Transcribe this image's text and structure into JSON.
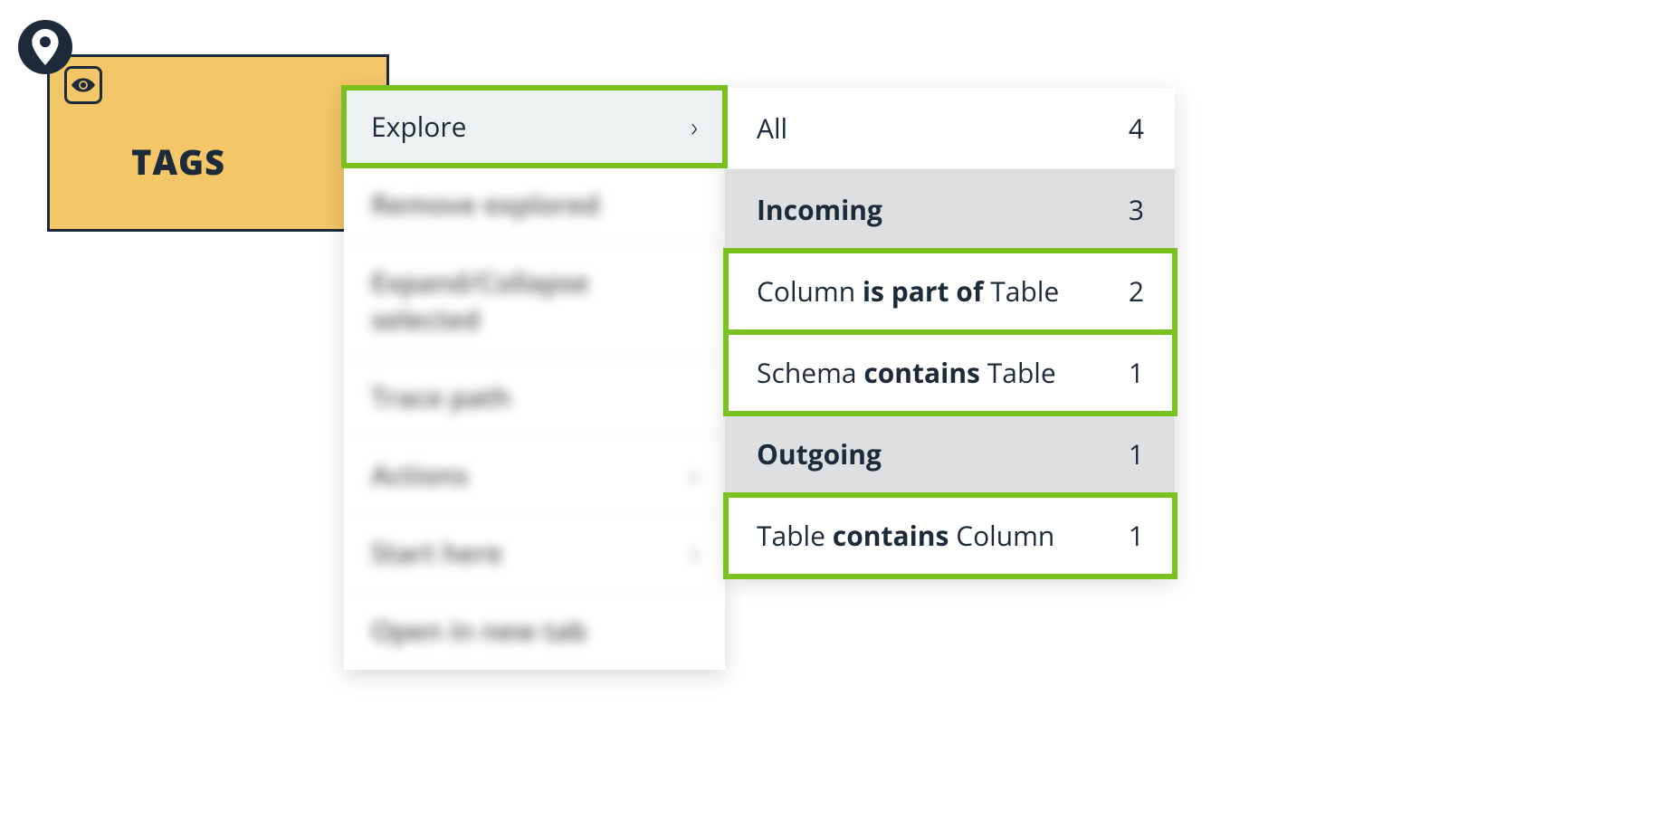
{
  "node": {
    "title": "TAGS",
    "icon": "eye-icon"
  },
  "menu": {
    "items": [
      {
        "label": "Explore",
        "arrow": true,
        "highlighted": true,
        "selected": true
      },
      {
        "label": "Remove explored",
        "blurred": true
      },
      {
        "label": "Expand/Collapse selected",
        "blurred": true
      },
      {
        "label": "Trace path",
        "blurred": true
      },
      {
        "label": "Actions",
        "arrow": true,
        "blurred": true
      },
      {
        "label": "Start here",
        "arrow": true,
        "blurred": true
      },
      {
        "label": "Open in new tab",
        "blurred": true
      }
    ]
  },
  "submenu": {
    "items": [
      {
        "label_pre": "All",
        "label_bold": "",
        "label_post": "",
        "count": "4",
        "section": false,
        "highlighted": false
      },
      {
        "label_pre": "Incoming",
        "label_bold": "",
        "label_post": "",
        "count": "3",
        "section": true,
        "highlighted": false
      },
      {
        "label_pre": "Column ",
        "label_bold": "is part of",
        "label_post": " Table",
        "count": "2",
        "section": false,
        "highlighted": true
      },
      {
        "label_pre": "Schema ",
        "label_bold": "contains",
        "label_post": " Table",
        "count": "1",
        "section": false,
        "highlighted": true
      },
      {
        "label_pre": "Outgoing",
        "label_bold": "",
        "label_post": "",
        "count": "1",
        "section": true,
        "highlighted": false
      },
      {
        "label_pre": "Table ",
        "label_bold": "contains",
        "label_post": " Column",
        "count": "1",
        "section": false,
        "highlighted": true
      }
    ]
  }
}
